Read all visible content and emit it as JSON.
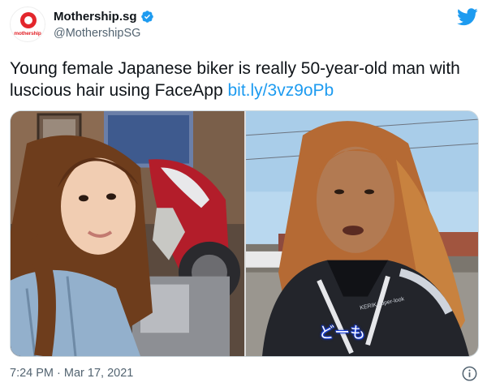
{
  "author": {
    "display_name": "Mothership.sg",
    "handle": "@MothershipSG",
    "avatar_text": "mothership",
    "verified": true
  },
  "tweet": {
    "text": "Young female Japanese biker is really 50-year-old man with luscious hair using FaceApp",
    "link": "bit.ly/3vz9oPb"
  },
  "media": {
    "right_subtitle": "どーも",
    "jacket_print": "KERIK super-look"
  },
  "footer": {
    "timestamp": "7:24 PM · Mar 17, 2021"
  },
  "colors": {
    "link": "#1d9bf0",
    "twitter_brand": "#1d9bf0",
    "verified": "#1d9bf0",
    "mothership_red": "#e3262c"
  },
  "icons": {
    "twitter": "twitter-bird-icon",
    "verified": "verified-badge-icon",
    "info": "info-icon"
  }
}
